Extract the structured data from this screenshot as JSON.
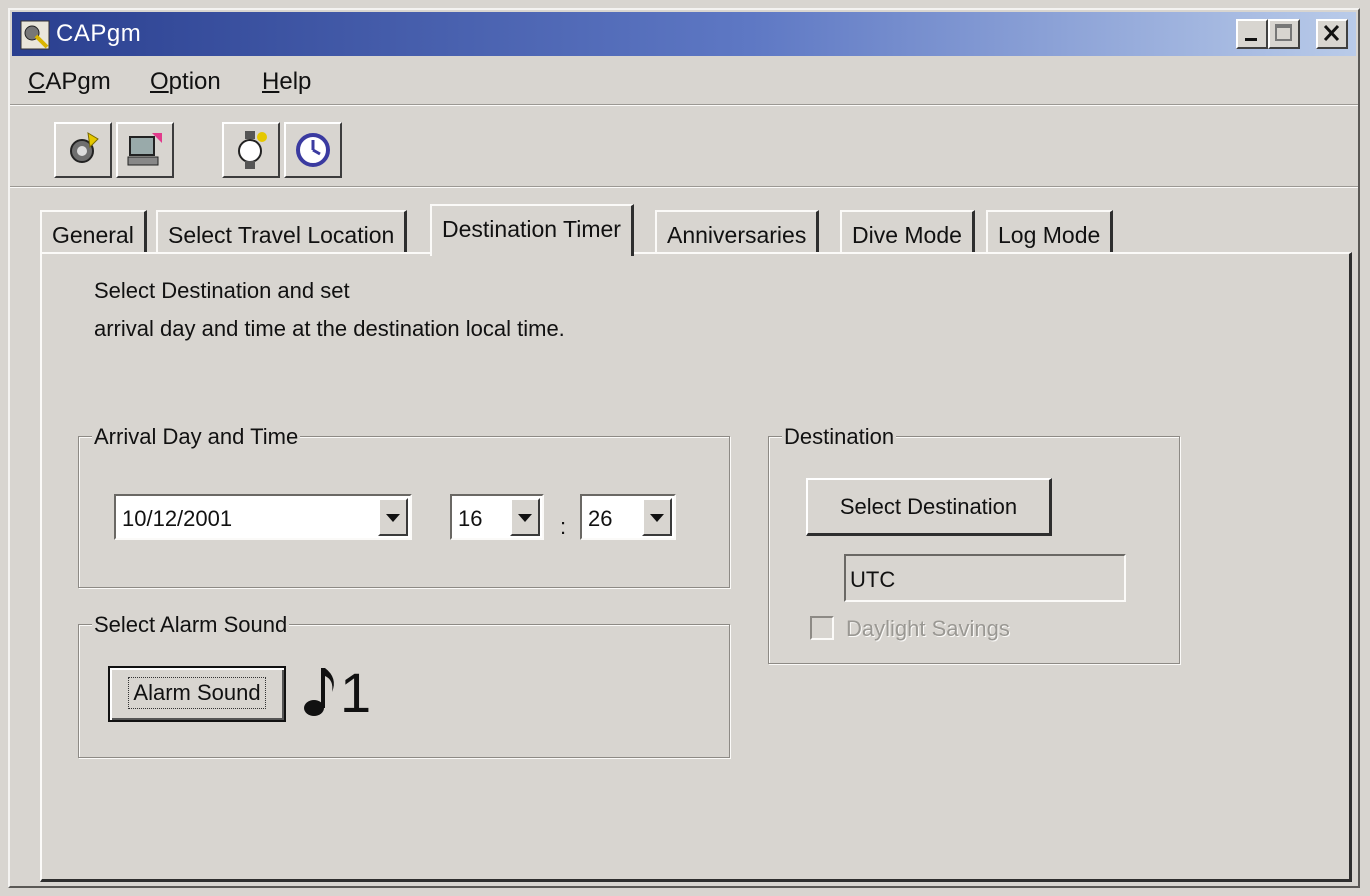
{
  "window": {
    "title": "CAPgm",
    "controls": {
      "minimize": "minimize",
      "maximize": "maximize",
      "close": "close"
    }
  },
  "menu": {
    "items": [
      {
        "label": "CAPgm",
        "accel": "C",
        "rest": "APgm"
      },
      {
        "label": "Option",
        "accel": "O",
        "rest": "ption"
      },
      {
        "label": "Help",
        "accel": "H",
        "rest": "elp"
      }
    ]
  },
  "toolbar": {
    "buttons": [
      "watch-sync-icon",
      "computer-transfer-icon",
      "watch-settings-icon",
      "clock-icon"
    ]
  },
  "tabs": [
    {
      "label": "General"
    },
    {
      "label": "Select Travel Location"
    },
    {
      "label": "Destination Timer",
      "active": true
    },
    {
      "label": "Anniversaries"
    },
    {
      "label": "Dive Mode"
    },
    {
      "label": "Log Mode"
    }
  ],
  "panel": {
    "instruction_line1": "Select Destination and set",
    "instruction_line2": "arrival day and time at the destination local time.",
    "arrival": {
      "label": "Arrival Day and Time",
      "date": "10/12/2001",
      "hour": "16",
      "separator": ":",
      "minute": "26"
    },
    "alarm": {
      "label": "Select Alarm Sound",
      "button_label": "Alarm Sound",
      "sound_number": "1"
    },
    "destination": {
      "label": "Destination",
      "button_label": "Select Destination",
      "value": "UTC",
      "daylight_label": "Daylight Savings",
      "daylight_checked": false
    }
  }
}
